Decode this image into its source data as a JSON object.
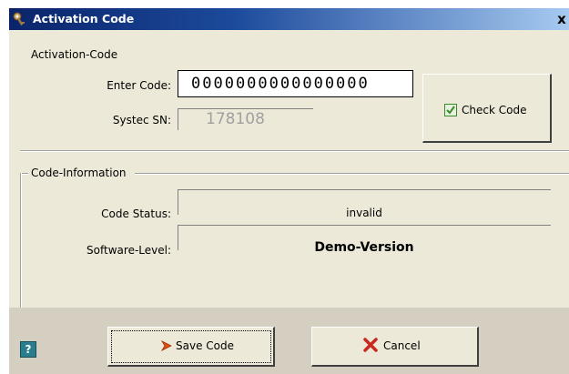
{
  "window": {
    "title": "Activation Code",
    "close_glyph": "x"
  },
  "activation": {
    "group_label": "Activation-Code",
    "enter_code_label": "Enter Code:",
    "enter_code_value": "0000000000000000",
    "systec_sn_label": "Systec SN:",
    "systec_sn_value": "178108",
    "check_code_label": "Check Code"
  },
  "info": {
    "group_label": "Code-Information",
    "code_status_label": "Code Status:",
    "code_status_value": "invalid",
    "software_level_label": "Software-Level:",
    "software_level_value": "Demo-Version"
  },
  "footer": {
    "help_glyph": "?",
    "save_label": "Save Code",
    "cancel_label": "Cancel"
  },
  "colors": {
    "title_bar_start": "#0a246a",
    "dialog_bg": "#ece9d8",
    "check_icon": "#3a8a2a",
    "save_icon": "#e05010",
    "cancel_icon": "#c8281e",
    "help_icon": "#2a7d8c"
  },
  "icons": {
    "title": "key-icon",
    "check": "checkbox-checked-icon",
    "save": "arrow-right-icon",
    "cancel": "x-icon",
    "help": "question-icon"
  }
}
